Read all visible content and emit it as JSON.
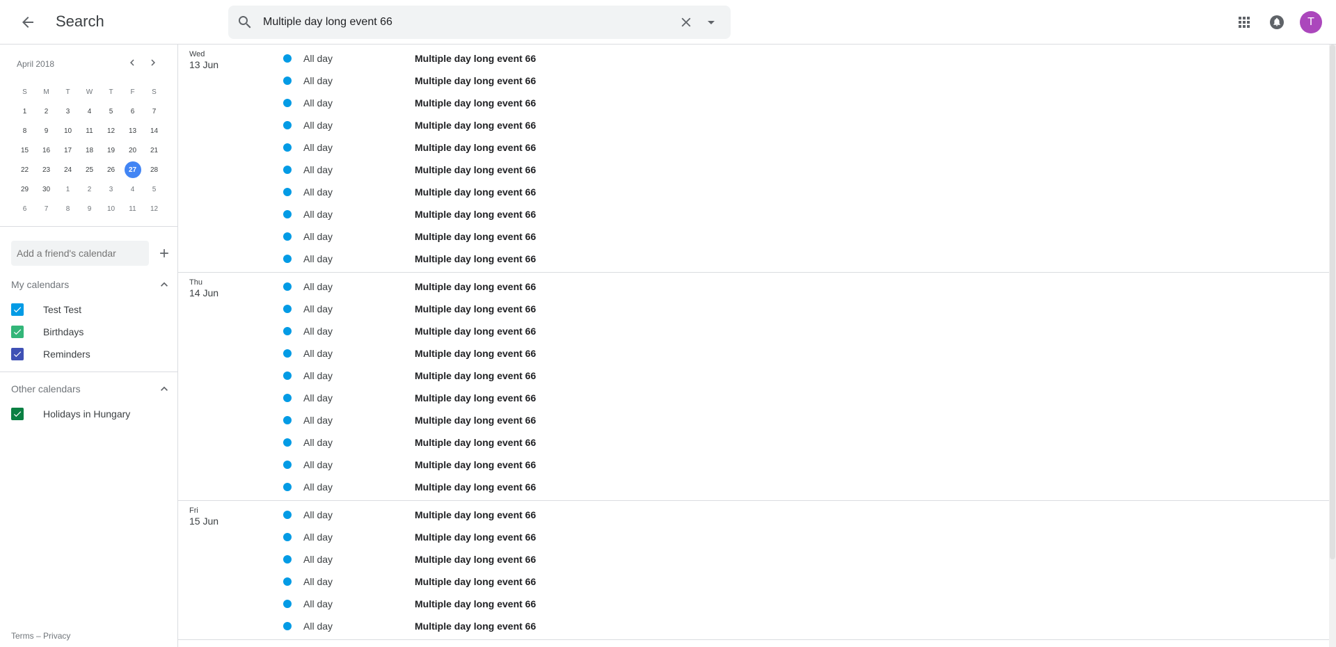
{
  "header": {
    "title": "Search",
    "search_value": "Multiple day long event 66",
    "avatar_letter": "T"
  },
  "mini_calendar": {
    "month_label": "April 2018",
    "weekdays": [
      "S",
      "M",
      "T",
      "W",
      "T",
      "F",
      "S"
    ],
    "weeks": [
      [
        "1",
        "2",
        "3",
        "4",
        "5",
        "6",
        "7"
      ],
      [
        "8",
        "9",
        "10",
        "11",
        "12",
        "13",
        "14"
      ],
      [
        "15",
        "16",
        "17",
        "18",
        "19",
        "20",
        "21"
      ],
      [
        "22",
        "23",
        "24",
        "25",
        "26",
        "27",
        "28"
      ],
      [
        "29",
        "30",
        "1",
        "2",
        "3",
        "4",
        "5"
      ],
      [
        "6",
        "7",
        "8",
        "9",
        "10",
        "11",
        "12"
      ]
    ],
    "today": "27"
  },
  "sidebar": {
    "friend_placeholder": "Add a friend's calendar",
    "my_calendars_label": "My calendars",
    "my_calendars": [
      {
        "name": "Test Test",
        "color": "#039be5"
      },
      {
        "name": "Birthdays",
        "color": "#33b679"
      },
      {
        "name": "Reminders",
        "color": "#3f51b5"
      }
    ],
    "other_calendars_label": "Other calendars",
    "other_calendars": [
      {
        "name": "Holidays in Hungary",
        "color": "#0b8043"
      }
    ],
    "footer": {
      "terms": "Terms",
      "dash": "–",
      "privacy": "Privacy"
    }
  },
  "event_color": "#039be5",
  "results": [
    {
      "dow": "Wed",
      "date": "13 Jun",
      "events": [
        {
          "time": "All day",
          "title": "Multiple day long event 66"
        },
        {
          "time": "All day",
          "title": "Multiple day long event 66"
        },
        {
          "time": "All day",
          "title": "Multiple day long event 66"
        },
        {
          "time": "All day",
          "title": "Multiple day long event 66"
        },
        {
          "time": "All day",
          "title": "Multiple day long event 66"
        },
        {
          "time": "All day",
          "title": "Multiple day long event 66"
        },
        {
          "time": "All day",
          "title": "Multiple day long event 66"
        },
        {
          "time": "All day",
          "title": "Multiple day long event 66"
        },
        {
          "time": "All day",
          "title": "Multiple day long event 66"
        },
        {
          "time": "All day",
          "title": "Multiple day long event 66"
        }
      ]
    },
    {
      "dow": "Thu",
      "date": "14 Jun",
      "events": [
        {
          "time": "All day",
          "title": "Multiple day long event 66"
        },
        {
          "time": "All day",
          "title": "Multiple day long event 66"
        },
        {
          "time": "All day",
          "title": "Multiple day long event 66"
        },
        {
          "time": "All day",
          "title": "Multiple day long event 66"
        },
        {
          "time": "All day",
          "title": "Multiple day long event 66"
        },
        {
          "time": "All day",
          "title": "Multiple day long event 66"
        },
        {
          "time": "All day",
          "title": "Multiple day long event 66"
        },
        {
          "time": "All day",
          "title": "Multiple day long event 66"
        },
        {
          "time": "All day",
          "title": "Multiple day long event 66"
        },
        {
          "time": "All day",
          "title": "Multiple day long event 66"
        }
      ]
    },
    {
      "dow": "Fri",
      "date": "15 Jun",
      "events": [
        {
          "time": "All day",
          "title": "Multiple day long event 66"
        },
        {
          "time": "All day",
          "title": "Multiple day long event 66"
        },
        {
          "time": "All day",
          "title": "Multiple day long event 66"
        },
        {
          "time": "All day",
          "title": "Multiple day long event 66"
        },
        {
          "time": "All day",
          "title": "Multiple day long event 66"
        },
        {
          "time": "All day",
          "title": "Multiple day long event 66"
        }
      ]
    }
  ]
}
